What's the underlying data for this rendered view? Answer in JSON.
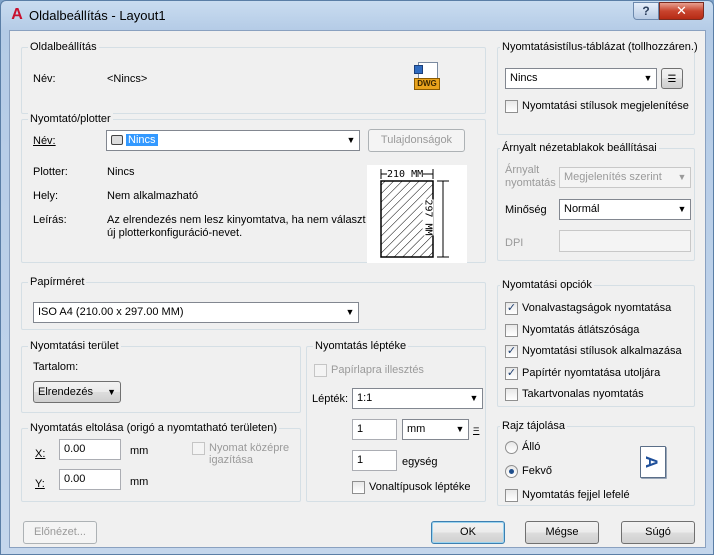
{
  "window": {
    "title": "Oldalbeállítás - Layout1",
    "help": "?",
    "close": "✕"
  },
  "page_setup": {
    "legend": "Oldalbeállítás",
    "name_label": "Név:",
    "name_value": "<Nincs>",
    "icon_text": "DWG"
  },
  "plotter": {
    "legend": "Nyomtató/plotter",
    "name_label": "Név:",
    "name_value": "Nincs",
    "properties_btn": "Tulajdonságok",
    "plotter_label": "Plotter:",
    "plotter_value": "Nincs",
    "location_label": "Hely:",
    "location_value": "Nem alkalmazható",
    "desc_label": "Leírás:",
    "desc_line1": "Az elrendezés nem lesz kinyomtatva, ha nem választ",
    "desc_line2": "új plotterkonfiguráció-nevet.",
    "preview_width": "210 MM",
    "preview_height": "297 MM"
  },
  "paper": {
    "legend": "Papírméret",
    "value": "ISO A4 (210.00 x 297.00 MM)"
  },
  "area": {
    "legend": "Nyomtatási terület",
    "content_label": "Tartalom:",
    "content_value": "Elrendezés"
  },
  "offset": {
    "legend": "Nyomtatás eltolása (origó a nyomtatható területen)",
    "x_label": "X:",
    "x_value": "0.00",
    "y_label": "Y:",
    "y_value": "0.00",
    "unit": "mm",
    "center_label1": "Nyomat középre",
    "center_label2": "igazítása"
  },
  "scale": {
    "legend": "Nyomtatás léptéke",
    "fit_label": "Papírlapra illesztés",
    "scale_label": "Lépték:",
    "scale_value": "1:1",
    "num_value": "1",
    "unit_value": "mm",
    "equals": "=",
    "den_value": "1",
    "unit_label": "egység",
    "lineweights_label": "Vonaltípusok léptéke"
  },
  "style_table": {
    "legend": "Nyomtatásistílus-táblázat (tollhozzáren.)",
    "value": "Nincs",
    "show_label": "Nyomtatási stílusok megjelenítése"
  },
  "shaded": {
    "legend": "Árnyalt nézetablakok beállításai",
    "shade_label1": "Árnyalt",
    "shade_label2": "nyomtatás",
    "shade_value": "Megjelenítés szerint",
    "quality_label": "Minőség",
    "quality_value": "Normál",
    "dpi_label": "DPI"
  },
  "options": {
    "legend": "Nyomtatási opciók",
    "items": [
      {
        "label": "Vonalvastagságok nyomtatása",
        "checked": true
      },
      {
        "label": "Nyomtatás átlátszósága",
        "checked": false
      },
      {
        "label": "Nyomtatási stílusok alkalmazása",
        "checked": true
      },
      {
        "label": "Papírtér nyomtatása utoljára",
        "checked": true
      },
      {
        "label": "Takartvonalas nyomtatás",
        "checked": false
      }
    ]
  },
  "orientation": {
    "legend": "Rajz tájolása",
    "portrait": "Álló",
    "landscape": "Fekvő",
    "upside_down": "Nyomtatás fejjel lefelé",
    "icon_letter": "A"
  },
  "buttons": {
    "preview": "Előnézet...",
    "ok": "OK",
    "cancel": "Mégse",
    "help": "Súgó"
  },
  "check_glyph": "✓"
}
